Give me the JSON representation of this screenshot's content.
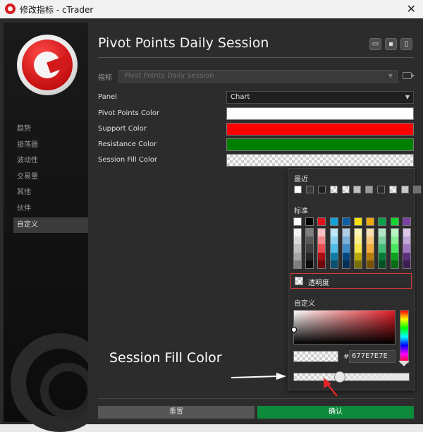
{
  "window": {
    "title": "修改指标 - cTrader",
    "close_glyph": "✕"
  },
  "sidebar": {
    "items": [
      {
        "label": "趋势"
      },
      {
        "label": "振荡器"
      },
      {
        "label": "波动性"
      },
      {
        "label": "交易量"
      },
      {
        "label": "其他"
      },
      {
        "label": "伙伴"
      },
      {
        "label": "自定义",
        "active": true
      }
    ]
  },
  "main": {
    "title": "Pivot Points Daily Session",
    "toolbar_icons": [
      "folder-icon",
      "save-icon",
      "trash-icon"
    ],
    "indicator_label": "指标",
    "indicator_value": "Pivot Points Daily Session",
    "params": [
      {
        "label": "Panel",
        "value": "Chart",
        "kind": "select"
      },
      {
        "label": "Pivot Points Color",
        "color": "#ffffff"
      },
      {
        "label": "Support Color",
        "color": "#ff0000"
      },
      {
        "label": "Resistance Color",
        "color": "#008000"
      },
      {
        "label": "Session Fill Color",
        "color": "transparent"
      }
    ]
  },
  "footer": {
    "reset_label": "重置",
    "ok_label": "确认"
  },
  "color_picker": {
    "recent_label": "最近",
    "recent_colors": [
      "#ffffff",
      "#3a3a3a",
      "#1e1e1e",
      "checker",
      "checker",
      "#bdbdbd",
      "#9a9a9a",
      "#2a2a2a",
      "checker",
      "#c8c8c8",
      "#6f6f6f"
    ],
    "standard_label": "标准",
    "standard_top": [
      "#ffffff",
      "#000000",
      "#e0121b",
      "#13a3dc",
      "#0a5fa8",
      "#f5e20b",
      "#f0a70e",
      "#0aa14a",
      "#12d629",
      "#7b3fa8"
    ],
    "standard_ramps": [
      [
        "#f2f2f2",
        "#d8d8d8",
        "#bfbfbf",
        "#a5a5a5",
        "#7f7f7f"
      ],
      [
        "#7f7f7f",
        "#595959",
        "#3f3f3f",
        "#262626",
        "#0c0c0c"
      ],
      [
        "#f8c0c2",
        "#f2888c",
        "#eb4c52",
        "#a80d14",
        "#6f090d"
      ],
      [
        "#bde6f6",
        "#8ad3ef",
        "#4dbde8",
        "#0e7aa5",
        "#0a516e"
      ],
      [
        "#b0cde8",
        "#7ab0d9",
        "#3d8bc7",
        "#08477e",
        "#052f54"
      ],
      [
        "#fcf6b5",
        "#f9ef86",
        "#f7e649",
        "#b7a808",
        "#7a7005"
      ],
      [
        "#fbe1b0",
        "#f8c97a",
        "#f4ad3d",
        "#b47c0a",
        "#785307"
      ],
      [
        "#b4e4c7",
        "#7ed2a1",
        "#3fbb73",
        "#077837",
        "#054f24"
      ],
      [
        "#b8f5c0",
        "#85ef93",
        "#48e65b",
        "#0ea11f",
        "#096b14"
      ],
      [
        "#dbc9e8",
        "#c2a5d7",
        "#a178c0",
        "#5c2f7e",
        "#3d1f54"
      ]
    ],
    "transparency_label": "透明度",
    "custom_label": "自定义",
    "hex_hash": "#",
    "hex_value": "677E7E7E",
    "alpha_level": 0.4
  },
  "annotation": {
    "text": "Session Fill Color"
  }
}
